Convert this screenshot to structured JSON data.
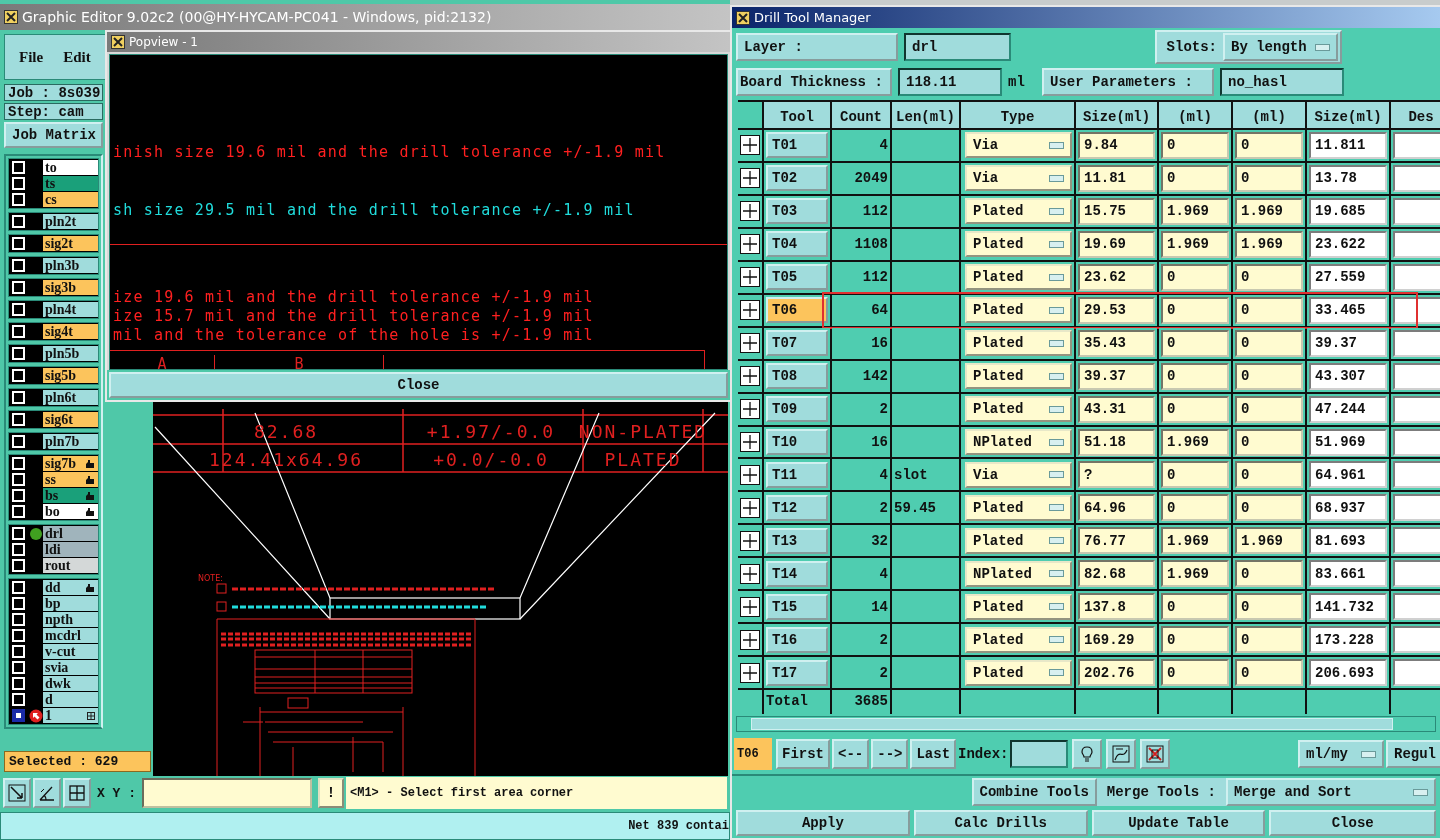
{
  "editor": {
    "title": "Graphic Editor 9.02c2 (00@HY-HYCAM-PC041 - Windows, pid:2132)",
    "menu": [
      "File",
      "Edit"
    ],
    "job": "Job : 8s039",
    "step": "Step: cam",
    "job_matrix": "Job Matrix",
    "layer_groups": [
      {
        "layers": [
          {
            "name": "to",
            "color": "#ffffff",
            "selected": false,
            "work_layer": false,
            "kind": "plain"
          },
          {
            "name": "ts",
            "color": "#1aa07a",
            "selected": false,
            "work_layer": false,
            "kind": "plain"
          },
          {
            "name": "cs",
            "color": "#fcc45c",
            "selected": false,
            "work_layer": false,
            "kind": "plain"
          }
        ]
      },
      {
        "layers": [
          {
            "name": "pln2t",
            "color": "#a0dcdc",
            "selected": false,
            "work_layer": false,
            "kind": "plain"
          }
        ]
      },
      {
        "layers": [
          {
            "name": "sig2t",
            "color": "#fcc45c",
            "selected": false,
            "work_layer": false,
            "kind": "plain"
          }
        ]
      },
      {
        "layers": [
          {
            "name": "pln3b",
            "color": "#a0dcdc",
            "selected": false,
            "work_layer": false,
            "kind": "plain"
          }
        ]
      },
      {
        "layers": [
          {
            "name": "sig3b",
            "color": "#fcc45c",
            "selected": false,
            "work_layer": false,
            "kind": "plain"
          }
        ]
      },
      {
        "layers": [
          {
            "name": "pln4t",
            "color": "#a0dcdc",
            "selected": false,
            "work_layer": false,
            "kind": "plain"
          }
        ]
      },
      {
        "layers": [
          {
            "name": "sig4t",
            "color": "#fcc45c",
            "selected": false,
            "work_layer": false,
            "kind": "plain"
          }
        ]
      },
      {
        "layers": [
          {
            "name": "pln5b",
            "color": "#a0dcdc",
            "selected": false,
            "work_layer": false,
            "kind": "plain"
          }
        ]
      },
      {
        "layers": [
          {
            "name": "sig5b",
            "color": "#fcc45c",
            "selected": false,
            "work_layer": false,
            "kind": "plain"
          }
        ]
      },
      {
        "layers": [
          {
            "name": "pln6t",
            "color": "#a0dcdc",
            "selected": false,
            "work_layer": false,
            "kind": "plain"
          }
        ]
      },
      {
        "layers": [
          {
            "name": "sig6t",
            "color": "#fcc45c",
            "selected": false,
            "work_layer": false,
            "kind": "plain"
          }
        ]
      },
      {
        "layers": [
          {
            "name": "pln7b",
            "color": "#a0dcdc",
            "selected": false,
            "work_layer": false,
            "kind": "plain"
          }
        ]
      },
      {
        "layers": [
          {
            "name": "sig7b",
            "color": "#fcc45c",
            "selected": false,
            "work_layer": false,
            "kind": "hand"
          },
          {
            "name": "ss",
            "color": "#fcc45c",
            "selected": false,
            "work_layer": false,
            "kind": "hand"
          },
          {
            "name": "bs",
            "color": "#1aa07a",
            "selected": false,
            "work_layer": false,
            "kind": "hand"
          },
          {
            "name": "bo",
            "color": "#ffffff",
            "selected": false,
            "work_layer": false,
            "kind": "hand"
          }
        ]
      },
      {
        "layers": [
          {
            "name": "drl",
            "color": "#a0b4bc",
            "selected": false,
            "work_layer": true,
            "kind": "plain"
          },
          {
            "name": "ldi",
            "color": "#a0b4bc",
            "selected": false,
            "work_layer": false,
            "kind": "plain"
          },
          {
            "name": "rout",
            "color": "#d4d8d8",
            "selected": false,
            "work_layer": false,
            "kind": "plain"
          }
        ]
      },
      {
        "layers": [
          {
            "name": "dd",
            "color": "#a0dcdc",
            "selected": false,
            "work_layer": false,
            "kind": "hand"
          },
          {
            "name": "bp",
            "color": "#a0dcdc",
            "selected": false,
            "work_layer": false,
            "kind": "plain"
          },
          {
            "name": "npth",
            "color": "#a0dcdc",
            "selected": false,
            "work_layer": false,
            "kind": "plain"
          },
          {
            "name": "mcdrl",
            "color": "#a0dcdc",
            "selected": false,
            "work_layer": false,
            "kind": "plain"
          },
          {
            "name": "v-cut",
            "color": "#a0dcdc",
            "selected": false,
            "work_layer": false,
            "kind": "plain"
          },
          {
            "name": "svia",
            "color": "#a0dcdc",
            "selected": false,
            "work_layer": false,
            "kind": "plain"
          },
          {
            "name": "dwk",
            "color": "#a0dcdc",
            "selected": false,
            "work_layer": false,
            "kind": "plain"
          },
          {
            "name": "d",
            "color": "#a0dcdc",
            "selected": false,
            "work_layer": false,
            "kind": "plain"
          },
          {
            "name": "1",
            "color": "#a0dcdc",
            "selected": true,
            "work_layer": false,
            "kind": "grid"
          }
        ]
      }
    ],
    "selected_count": "Selected : 629",
    "xy_label": "X Y :",
    "hint_button": "!",
    "prompt": "<M1> - Select first area corner",
    "status": "Net 839 contai"
  },
  "canvas": {
    "table_rows": [
      [
        "82.68",
        "+1.97/-0.0",
        "NON-PLATED"
      ],
      [
        "124.41x64.96",
        "+0.0/-0.0",
        "PLATED"
      ]
    ],
    "note": "NOTE:"
  },
  "popview": {
    "title": "Popview - 1",
    "lines": [
      {
        "text": "inish size 19.6 mil and the drill tolerance +/-1.9 mil",
        "color": "#ff2020"
      },
      {
        "text": "sh size 29.5 mil and the drill tolerance +/-1.9 mil",
        "color": "#20dcdc"
      },
      {
        "text": "ize 19.6 mil and the drill tolerance +/-1.9 mil",
        "color": "#ff2020"
      },
      {
        "text": "ize 15.7 mil and the drill tolerance +/-1.9 mil",
        "color": "#ff2020"
      },
      {
        "text": "mil and the tolerance of the hole is +/-1.9 mil",
        "color": "#ff2020"
      }
    ],
    "columns": [
      "A",
      "B"
    ],
    "close": "Close"
  },
  "drill_manager": {
    "title": "Drill Tool Manager",
    "layer_button": "Layer :",
    "layer": "drl",
    "slots_label": "Slots:",
    "slots": "By length",
    "thickness_label": "Board Thickness :",
    "thickness": "118.11",
    "unit": "ml",
    "user_params_button": "User Parameters :",
    "user_params": "no_hasl",
    "columns": [
      "Tool",
      "Count",
      "Len(ml)",
      "Type",
      "Size(ml)",
      "(ml)",
      "(ml)",
      "Size(ml)",
      "Des"
    ],
    "rows": [
      {
        "tool": "T01",
        "count": "4",
        "type": "Via",
        "finish": "9.84",
        "plus_tol": "0",
        "minus_tol": "0",
        "drill_size": "11.811",
        "selected": false,
        "outlined": false
      },
      {
        "tool": "T02",
        "count": "2049",
        "type": "Via",
        "finish": "11.81",
        "plus_tol": "0",
        "minus_tol": "0",
        "drill_size": "13.78",
        "selected": false,
        "outlined": false
      },
      {
        "tool": "T03",
        "count": "112",
        "type": "Plated",
        "finish": "15.75",
        "plus_tol": "1.969",
        "minus_tol": "1.969",
        "drill_size": "19.685",
        "selected": false,
        "outlined": false
      },
      {
        "tool": "T04",
        "count": "1108",
        "type": "Plated",
        "finish": "19.69",
        "plus_tol": "1.969",
        "minus_tol": "1.969",
        "drill_size": "23.622",
        "selected": false,
        "outlined": false
      },
      {
        "tool": "T05",
        "count": "112",
        "type": "Plated",
        "finish": "23.62",
        "plus_tol": "0",
        "minus_tol": "0",
        "drill_size": "27.559",
        "selected": false,
        "outlined": false
      },
      {
        "tool": "T06",
        "count": "64",
        "type": "Plated",
        "finish": "29.53",
        "plus_tol": "0",
        "minus_tol": "0",
        "drill_size": "33.465",
        "selected": true,
        "outlined": true
      },
      {
        "tool": "T07",
        "count": "16",
        "type": "Plated",
        "finish": "35.43",
        "plus_tol": "0",
        "minus_tol": "0",
        "drill_size": "39.37",
        "selected": false,
        "outlined": false
      },
      {
        "tool": "T08",
        "count": "142",
        "type": "Plated",
        "finish": "39.37",
        "plus_tol": "0",
        "minus_tol": "0",
        "drill_size": "43.307",
        "selected": false,
        "outlined": false
      },
      {
        "tool": "T09",
        "count": "2",
        "type": "Plated",
        "finish": "43.31",
        "plus_tol": "0",
        "minus_tol": "0",
        "drill_size": "47.244",
        "selected": false,
        "outlined": false
      },
      {
        "tool": "T10",
        "count": "16",
        "type": "NPlated",
        "finish": "51.18",
        "plus_tol": "1.969",
        "minus_tol": "0",
        "drill_size": "51.969",
        "selected": false,
        "outlined": false
      },
      {
        "tool": "T11",
        "count": "4",
        "slot_len": "slot",
        "type": "Via",
        "finish": "?",
        "plus_tol": "0",
        "minus_tol": "0",
        "drill_size": "64.961",
        "selected": false,
        "outlined": false
      },
      {
        "tool": "T12",
        "count": "2",
        "slot_len": "59.45",
        "type": "Plated",
        "finish": "64.96",
        "plus_tol": "0",
        "minus_tol": "0",
        "drill_size": "68.937",
        "selected": false,
        "outlined": false
      },
      {
        "tool": "T13",
        "count": "32",
        "type": "Plated",
        "finish": "76.77",
        "plus_tol": "1.969",
        "minus_tol": "1.969",
        "drill_size": "81.693",
        "selected": false,
        "outlined": false
      },
      {
        "tool": "T14",
        "count": "4",
        "type": "NPlated",
        "finish": "82.68",
        "plus_tol": "1.969",
        "minus_tol": "0",
        "drill_size": "83.661",
        "selected": false,
        "outlined": false
      },
      {
        "tool": "T15",
        "count": "14",
        "type": "Plated",
        "finish": "137.8",
        "plus_tol": "0",
        "minus_tol": "0",
        "drill_size": "141.732",
        "selected": false,
        "outlined": false
      },
      {
        "tool": "T16",
        "count": "2",
        "type": "Plated",
        "finish": "169.29",
        "plus_tol": "0",
        "minus_tol": "0",
        "drill_size": "173.228",
        "selected": false,
        "outlined": false
      },
      {
        "tool": "T17",
        "count": "2",
        "type": "Plated",
        "finish": "202.76",
        "plus_tol": "0",
        "minus_tol": "0",
        "drill_size": "206.693",
        "selected": false,
        "outlined": false
      }
    ],
    "total": {
      "label": "Total",
      "count": "3685"
    },
    "current_tool": "T06",
    "nav_buttons": [
      "First",
      "<--",
      "-->",
      "Last"
    ],
    "index_label": "Index:",
    "units": "ml/my",
    "regul_button": "Regul",
    "combine_button": "Combine Tools",
    "merge_label": "Merge Tools :",
    "merge": "Merge and Sort",
    "actions": [
      "Apply",
      "Calc Drills",
      "Update Table",
      "Close"
    ]
  }
}
